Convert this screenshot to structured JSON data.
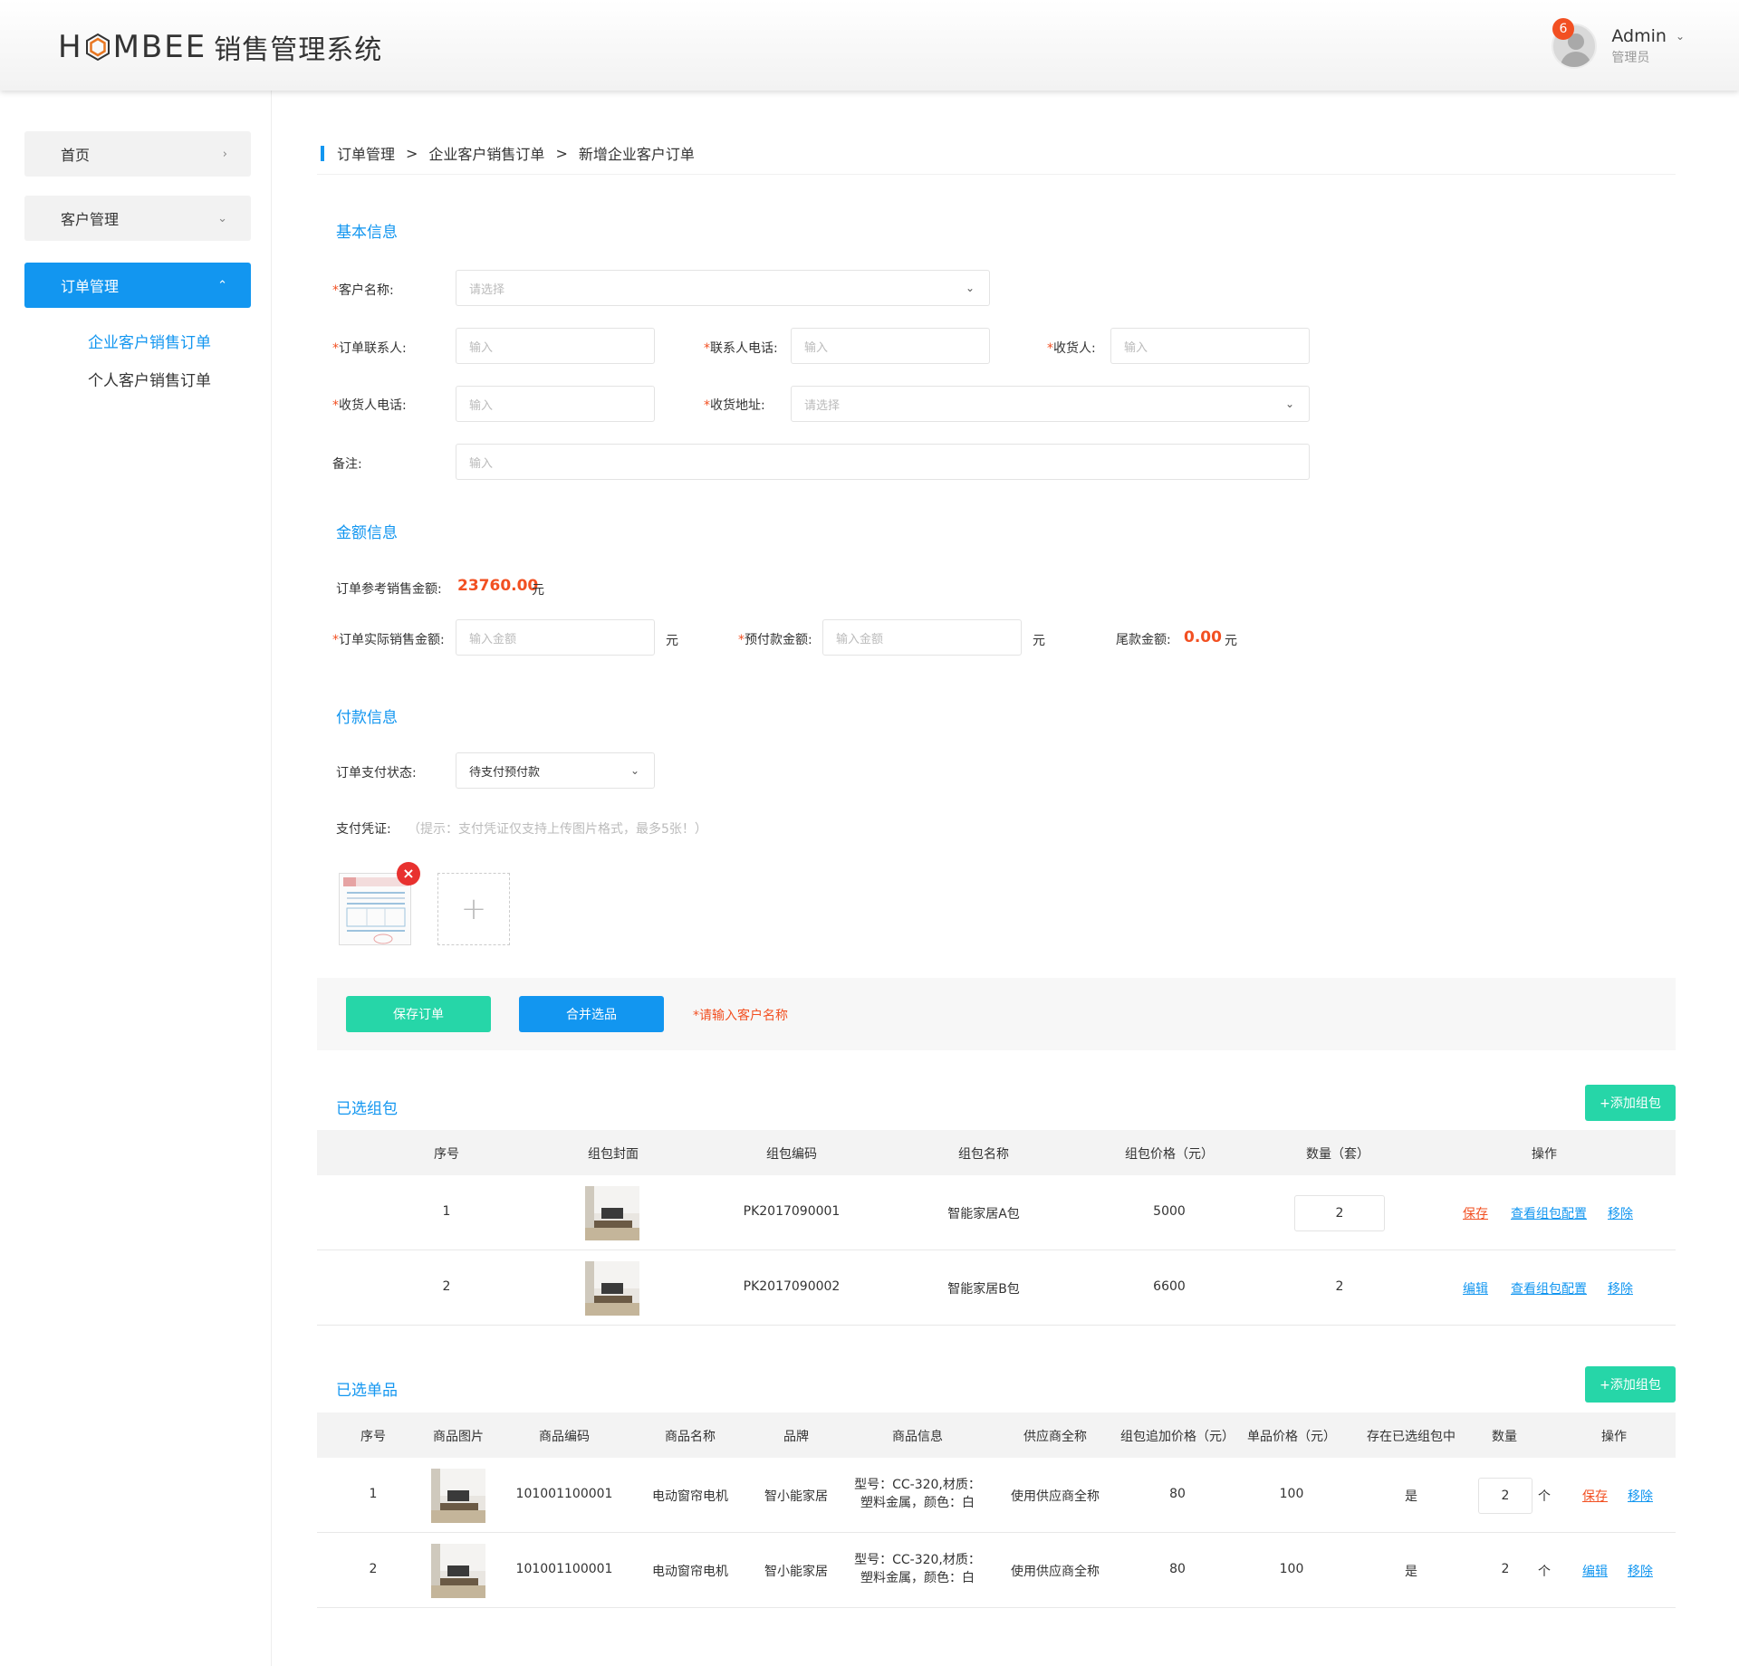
{
  "header": {
    "logo_h": "H",
    "logo_rest": "MBEE",
    "system_name": "销售管理系统",
    "badge_count": "6",
    "user_name": "Admin",
    "user_role": "管理员"
  },
  "sidebar": {
    "items": [
      {
        "label": "首页"
      },
      {
        "label": "客户管理"
      },
      {
        "label": "订单管理"
      }
    ],
    "sub_items": [
      {
        "label": "企业客户销售订单"
      },
      {
        "label": "个人客户销售订单"
      }
    ]
  },
  "breadcrumb": {
    "items": [
      "订单管理",
      "企业客户销售订单",
      "新增企业客户订单"
    ],
    "separator": ">"
  },
  "basic": {
    "title": "基本信息",
    "customer_label": "客户名称:",
    "customer_placeholder": "请选择",
    "contact_label": "订单联系人:",
    "contact_placeholder": "输入",
    "contact_phone_label": "联系人电话:",
    "contact_phone_placeholder": "输入",
    "receiver_label": "收货人:",
    "receiver_placeholder": "输入",
    "receiver_phone_label": "收货人电话:",
    "receiver_phone_placeholder": "输入",
    "address_label": "收货地址:",
    "address_placeholder": "请选择",
    "remark_label": "备注:",
    "remark_placeholder": "输入",
    "required_mark": "*"
  },
  "amount": {
    "title": "金额信息",
    "ref_label": "订单参考销售金额:",
    "ref_value": "23760.00",
    "unit": "元",
    "actual_label": "订单实际销售金额:",
    "actual_placeholder": "输入金额",
    "prepay_label": "预付款金额:",
    "prepay_placeholder": "输入金额",
    "balance_label": "尾款金额:",
    "balance_value": "0.00"
  },
  "payment": {
    "title": "付款信息",
    "status_label": "订单支付状态:",
    "status_value": "待支付预付款",
    "voucher_label": "支付凭证:",
    "voucher_hint": "（提示：支付凭证仅支持上传图片格式，最多5张！）"
  },
  "actions": {
    "save_order": "保存订单",
    "merge_items": "合并选品",
    "error": "*请输入客户名称"
  },
  "bundles": {
    "title": "已选组包",
    "add_label": "+添加组包",
    "columns": [
      "序号",
      "组包封面",
      "组包编码",
      "组包名称",
      "组包价格（元）",
      "数量（套）",
      "操作"
    ],
    "rows": [
      {
        "index": "1",
        "code": "PK2017090001",
        "name": "智能家居A包",
        "price": "5000",
        "qty": "2",
        "action1": "保存",
        "action2": "查看组包配置",
        "action3": "移除"
      },
      {
        "index": "2",
        "code": "PK2017090002",
        "name": "智能家居B包",
        "price": "6600",
        "qty": "2",
        "action1": "编辑",
        "action2": "查看组包配置",
        "action3": "移除"
      }
    ]
  },
  "singles": {
    "title": "已选单品",
    "add_label": "+添加组包",
    "columns": [
      "序号",
      "商品图片",
      "商品编码",
      "商品名称",
      "品牌",
      "商品信息",
      "供应商全称",
      "组包追加价格（元）",
      "单品价格（元）",
      "存在已选组包中",
      "数量",
      "操作"
    ],
    "rows": [
      {
        "index": "1",
        "code": "101001100001",
        "name": "电动窗帘电机",
        "brand": "智小能家居",
        "info1": "型号：CC-320,材质：",
        "info2": "塑料金属，颜色：白",
        "supplier": "使用供应商全称",
        "addon": "80",
        "price": "100",
        "in_bundle": "是",
        "qty": "2",
        "unit": "个",
        "action1": "保存",
        "action2": "移除"
      },
      {
        "index": "2",
        "code": "101001100001",
        "name": "电动窗帘电机",
        "brand": "智小能家居",
        "info1": "型号：CC-320,材质：",
        "info2": "塑料金属，颜色：白",
        "supplier": "使用供应商全称",
        "addon": "80",
        "price": "100",
        "in_bundle": "是",
        "qty": "2",
        "unit": "个",
        "action1": "编辑",
        "action2": "移除"
      }
    ]
  },
  "colors": {
    "primary": "#1296f0",
    "success": "#26d6a8",
    "danger": "#f25022",
    "logo_hex": "#e87722"
  },
  "icons": [
    "chevron-right-icon",
    "chevron-down-icon",
    "chevron-up-icon",
    "close-icon",
    "plus-icon",
    "avatar-icon",
    "hexagon-logo-icon"
  ]
}
